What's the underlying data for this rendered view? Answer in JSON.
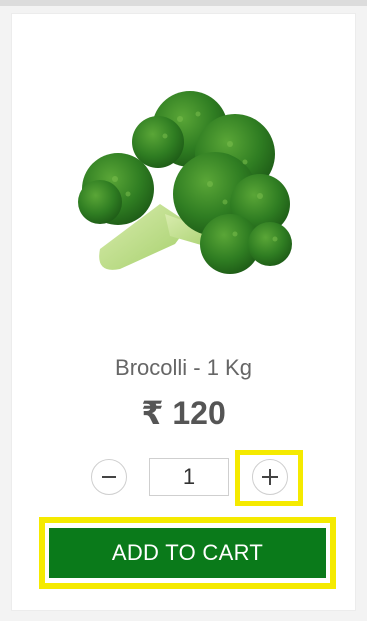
{
  "product": {
    "name": "Brocolli - 1 Kg",
    "price": "₹ 120",
    "image_subject": "broccoli"
  },
  "quantity": {
    "value": "1",
    "decrement_icon": "minus-icon",
    "increment_icon": "plus-icon"
  },
  "actions": {
    "add_to_cart_label": "ADD TO CART"
  },
  "colors": {
    "button_green": "#0a7a1a",
    "highlight_yellow": "#f5ea00",
    "name_text": "#666666",
    "price_text": "#555555"
  }
}
